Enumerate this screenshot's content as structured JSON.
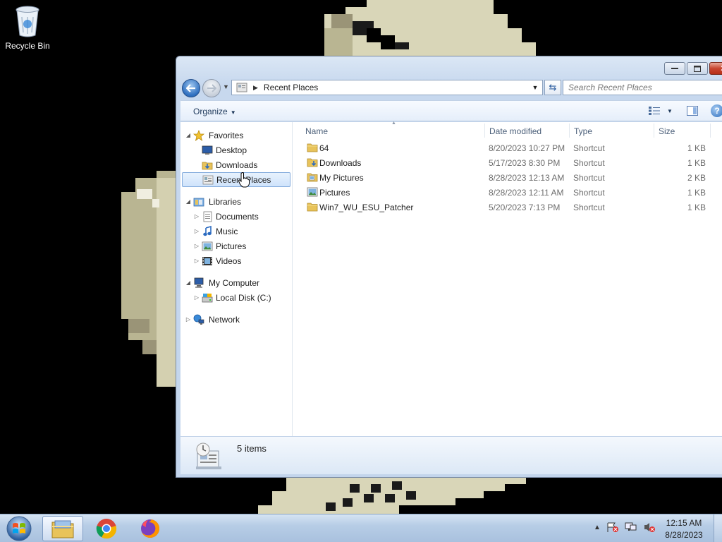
{
  "desktop": {
    "icons": [
      {
        "label": "Recycle Bin",
        "icon": "recycle-bin-icon"
      }
    ]
  },
  "window": {
    "address": {
      "path_label": "Recent Places"
    },
    "search": {
      "placeholder": "Search Recent Places"
    },
    "toolbar": {
      "organize_label": "Organize"
    },
    "nav": {
      "favorites": {
        "label": "Favorites",
        "items": [
          {
            "label": "Desktop"
          },
          {
            "label": "Downloads"
          },
          {
            "label": "Recent Places",
            "selected": true
          }
        ]
      },
      "libraries": {
        "label": "Libraries",
        "items": [
          {
            "label": "Documents"
          },
          {
            "label": "Music"
          },
          {
            "label": "Pictures"
          },
          {
            "label": "Videos"
          }
        ]
      },
      "computer": {
        "label": "My Computer",
        "items": [
          {
            "label": "Local Disk (C:)"
          }
        ]
      },
      "network": {
        "label": "Network"
      }
    },
    "columns": {
      "name": "Name",
      "date": "Date modified",
      "type": "Type",
      "size": "Size"
    },
    "files": [
      {
        "name": "64",
        "date": "8/20/2023 10:27 PM",
        "type": "Shortcut",
        "size": "1 KB",
        "icon": "folder-icon"
      },
      {
        "name": "Downloads",
        "date": "5/17/2023 8:30 PM",
        "type": "Shortcut",
        "size": "1 KB",
        "icon": "downloads-folder-icon"
      },
      {
        "name": "My Pictures",
        "date": "8/28/2023 12:13 AM",
        "type": "Shortcut",
        "size": "2 KB",
        "icon": "pictures-folder-icon"
      },
      {
        "name": "Pictures",
        "date": "8/28/2023 12:11 AM",
        "type": "Shortcut",
        "size": "1 KB",
        "icon": "pictures-library-icon"
      },
      {
        "name": "Win7_WU_ESU_Patcher",
        "date": "5/20/2023 7:13 PM",
        "type": "Shortcut",
        "size": "1 KB",
        "icon": "folder-icon"
      }
    ],
    "status": {
      "item_count": "5 items"
    }
  },
  "taskbar": {
    "pinned": [
      "windows-explorer-icon",
      "chrome-icon",
      "firefox-icon"
    ],
    "clock": {
      "time": "12:15 AM",
      "date": "8/28/2023"
    }
  },
  "colors": {
    "accent": "#2f6fbf",
    "selection": "#cfe3fb",
    "desktop": "#000000"
  }
}
